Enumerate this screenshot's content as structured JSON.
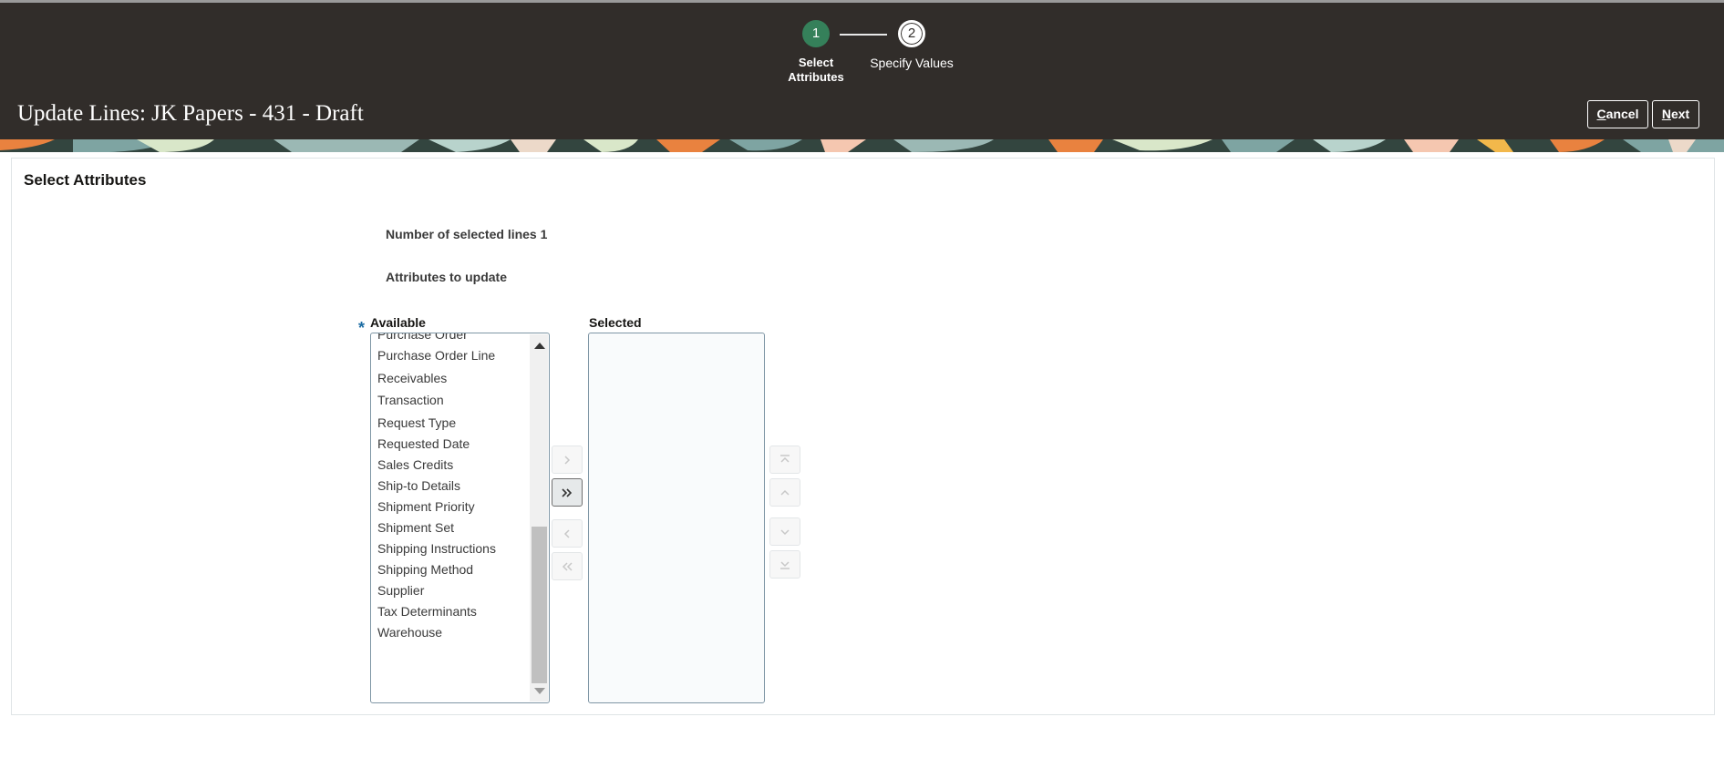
{
  "train": {
    "step1": {
      "number": "1",
      "label_line1": "Select",
      "label_line2": "Attributes"
    },
    "step2": {
      "number": "2",
      "label": "Specify Values"
    }
  },
  "header": {
    "title": "Update Lines: JK Papers - 431 - Draft",
    "cancel_first": "C",
    "cancel_rest": "ancel",
    "next_first": "N",
    "next_rest": "ext"
  },
  "section": {
    "title": "Select Attributes",
    "selected_lines_label": "Number of selected lines 1",
    "attributes_label": "Attributes to update"
  },
  "shuttle": {
    "required_marker": "*",
    "available_label": "Available",
    "selected_label": "Selected",
    "available_items": [
      "Purchase Order",
      "Purchase Order Line",
      "Receivables Transaction",
      "Request Type",
      "Requested Date",
      "Sales Credits",
      "Ship-to Details",
      "Shipment Priority",
      "Shipment Set",
      "Shipping Instructions",
      "Shipping Method",
      "Supplier",
      "Tax Determinants",
      "Warehouse"
    ],
    "selected_items": []
  },
  "colors": {
    "header_bg": "#312d2a",
    "step_active": "#35805a",
    "listbox_border": "#7f96a5"
  }
}
